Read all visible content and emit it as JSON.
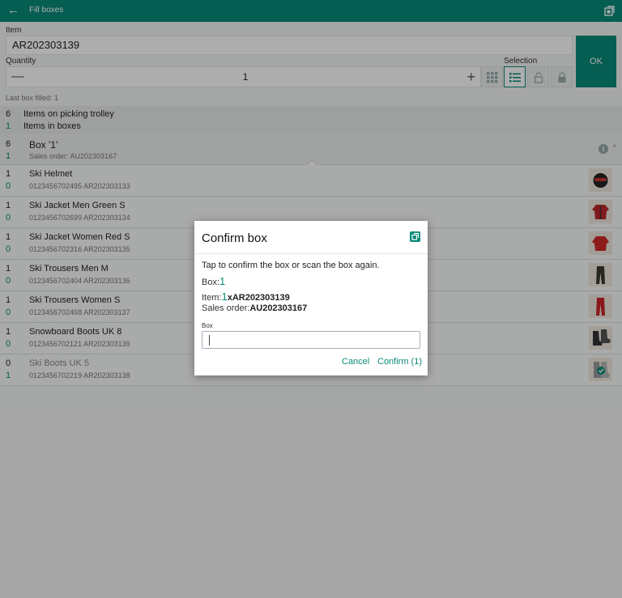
{
  "header": {
    "title": "Fill boxes",
    "back_icon": "arrow-left-icon",
    "scan_icon": "scan-icon"
  },
  "form": {
    "item_label": "Item",
    "item_value": "AR202303139",
    "quantity_label": "Quantity",
    "quantity_value": "1",
    "minus_symbol": "—",
    "plus_symbol": "+",
    "selection_label": "Selection",
    "ok_label": "OK",
    "last_box": "Last box filled: 1"
  },
  "summary": [
    {
      "count": "6",
      "label": "Items on picking trolley"
    },
    {
      "count": "1",
      "label": "Items in boxes"
    }
  ],
  "box": {
    "count_total": "6",
    "count_done": "1",
    "title": "Box '1'",
    "subtitle": "Sales order: AU202303167"
  },
  "items": [
    {
      "qty_total": "1",
      "qty_done": "0",
      "name": "Ski Helmet",
      "codes": "0123456702495 AR202303133"
    },
    {
      "qty_total": "1",
      "qty_done": "0",
      "name": "Ski Jacket Men Green S",
      "codes": "0123456702699 AR202303134"
    },
    {
      "qty_total": "1",
      "qty_done": "0",
      "name": "Ski Jacket Women Red S",
      "codes": "0123456702316 AR202303135"
    },
    {
      "qty_total": "1",
      "qty_done": "0",
      "name": "Ski Trousers Men M",
      "codes": "0123456702404 AR202303136"
    },
    {
      "qty_total": "1",
      "qty_done": "0",
      "name": "Ski Trousers Women S",
      "codes": "0123456702468 AR202303137"
    },
    {
      "qty_total": "1",
      "qty_done": "0",
      "name": "Snowboard Boots UK 8",
      "codes": "0123456702121 AR202303139"
    },
    {
      "qty_total": "0",
      "qty_done": "1",
      "name": "Ski Boots UK 5",
      "codes": "0123456702219 AR202303138"
    }
  ],
  "dialog": {
    "title": "Confirm box",
    "instruction": "Tap to confirm the box or scan the box again.",
    "box_label": "Box:",
    "box_value": "1",
    "item_label": "Item:",
    "item_qty": "1",
    "item_x": "x",
    "item_value": "AR202303139",
    "order_label": "Sales order:",
    "order_value": "AU202303167",
    "input_label": "Box",
    "input_value": "",
    "cancel_label": "Cancel",
    "confirm_label": "Confirm (1)"
  },
  "colors": {
    "primary": "#0a8a78",
    "background": "#f4f5f5"
  }
}
